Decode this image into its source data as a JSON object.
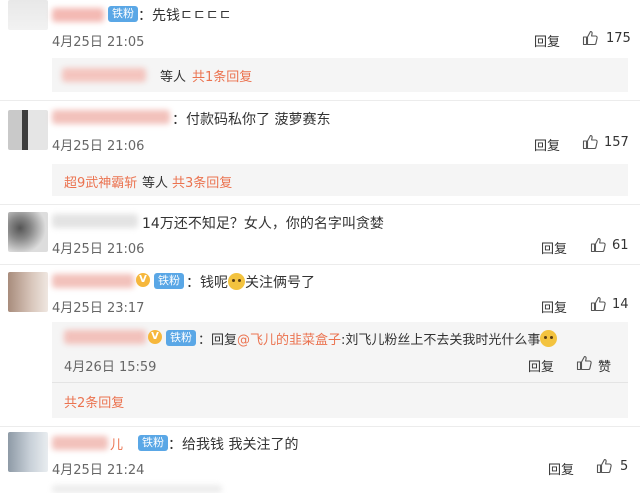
{
  "comments": [
    {
      "badge": "铁粉",
      "text": "：先钱ㄷㄷㄷㄷ",
      "date": "4月25日 21:05",
      "reply_label": "回复",
      "likes": "175",
      "sub": {
        "suffix": "等人",
        "count_link": "共1条回复"
      }
    },
    {
      "text": "：付款码私你了 菠萝赛东",
      "date": "4月25日 21:06",
      "reply_label": "回复",
      "likes": "157",
      "sub": {
        "name": "超9武神霸斩",
        "suffix": "等人",
        "count_link": "共3条回复"
      }
    },
    {
      "text": "14万还不知足？女人，你的名字叫贪婪",
      "date": "4月25日 21:06",
      "reply_label": "回复",
      "likes": "61"
    },
    {
      "v_badge": "V",
      "badge": "铁粉",
      "text_a": "：钱呢",
      "text_b": "关注俩号了",
      "date": "4月25日 23:17",
      "reply_label": "回复",
      "likes": "14",
      "nested_reply": {
        "v_badge": "V",
        "badge": "铁粉",
        "prefix": "：回复",
        "mention": "@飞儿的韭菜盒子",
        "body": ":刘飞儿粉丝上不去关我时光什么事",
        "date": "4月26日 15:59",
        "reply_label": "回复",
        "like_label": "赞"
      },
      "sub": {
        "count_link": "共2条回复"
      }
    },
    {
      "name_tail": "儿",
      "badge": "铁粉",
      "text": "：给我钱 我关注了的",
      "date": "4月25日 21:24",
      "reply_label": "回复",
      "likes": "5"
    }
  ],
  "colors": {
    "accent": "#eb7350",
    "badge": "#5aa7e6",
    "date": "#666666",
    "subbg": "#f5f5f5"
  },
  "icons": [
    "thumbs-up-icon",
    "smiley-emoji-icon",
    "verified-v-icon"
  ]
}
